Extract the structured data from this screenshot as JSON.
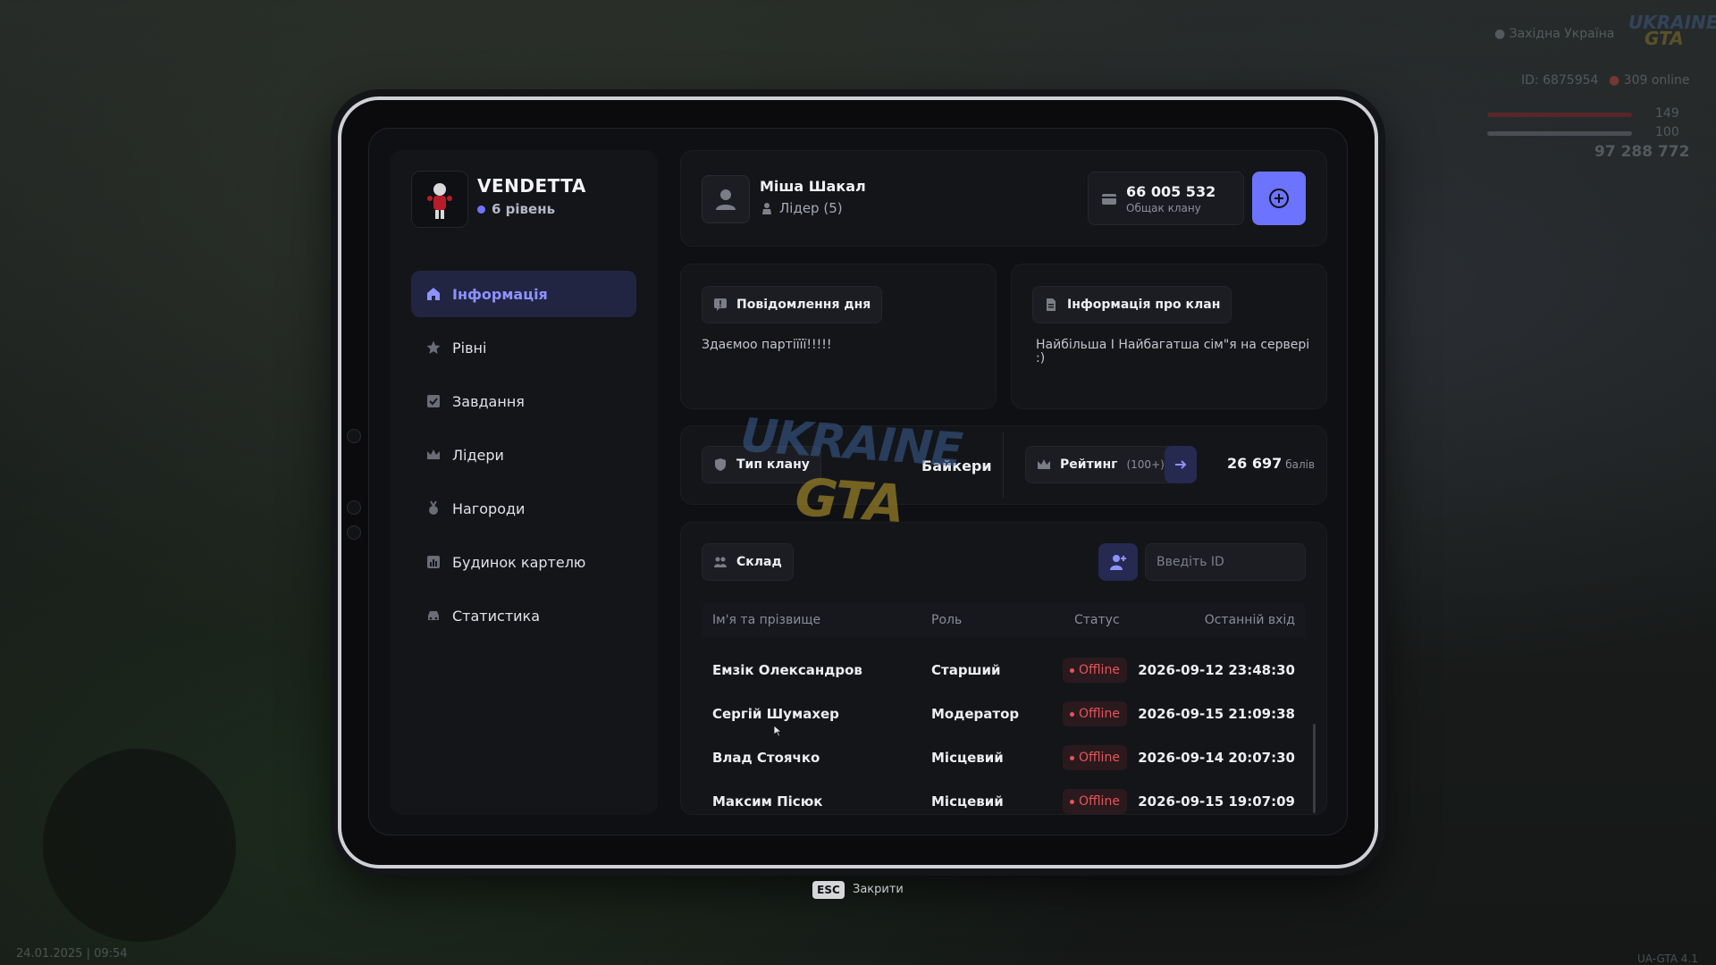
{
  "hud": {
    "region": "Західна Україна",
    "player_id": "ID: 6875954",
    "online": "309 online",
    "health": "149",
    "armor": "100",
    "money": "97 288 772",
    "version": "UA-GTA 4.1",
    "datetime": "24.01.2025 | 09:54",
    "logo_top": "UKRAINE",
    "logo_bottom": "GTA",
    "colors": {
      "health": "#d23a3a",
      "armor": "#9aa0a6"
    }
  },
  "sidebar": {
    "clan_name": "VENDETTA",
    "clan_level": "6 рівень",
    "items": [
      {
        "label": "Інформація",
        "icon": "home-icon",
        "active": true
      },
      {
        "label": "Рівні",
        "icon": "star-icon",
        "active": false
      },
      {
        "label": "Завдання",
        "icon": "checkbox-icon",
        "active": false
      },
      {
        "label": "Лідери",
        "icon": "crown-icon",
        "active": false
      },
      {
        "label": "Нагороди",
        "icon": "medal-icon",
        "active": false
      },
      {
        "label": "Будинок картелю",
        "icon": "chart-icon",
        "active": false
      },
      {
        "label": "Статистика",
        "icon": "car-icon",
        "active": false
      }
    ]
  },
  "leader": {
    "name": "Міша Шакал",
    "role": "Лідер (5)"
  },
  "bank": {
    "amount": "66 005 532",
    "label": "Общак клану"
  },
  "motd": {
    "title": "Повідомлення дня",
    "text": "Здаємоо партіїїї!!!!!"
  },
  "clan_info": {
    "title": "Інформація про клан",
    "text": "Найбільша І Найбагатша сім\"я на сервері :)"
  },
  "clan_type": {
    "title": "Тип клану",
    "value": "Байкери"
  },
  "rating": {
    "title": "Рейтинг",
    "sub": "(100+)",
    "points": "26 697",
    "unit": "балів"
  },
  "roster": {
    "title": "Склад",
    "id_placeholder": "Введіть ID",
    "columns": [
      "Ім'я та прізвище",
      "Роль",
      "Статус",
      "Останній вхід"
    ],
    "rows": [
      {
        "name": "Емзік Олександров",
        "role": "Старший",
        "status": "Offline",
        "last": "2026-09-12 23:48:30"
      },
      {
        "name": "Сергій Шумахер",
        "role": "Модератор",
        "status": "Offline",
        "last": "2026-09-15 21:09:38"
      },
      {
        "name": "Влад Стоячко",
        "role": "Місцевий",
        "status": "Offline",
        "last": "2026-09-14 20:07:30"
      },
      {
        "name": "Максим Пісюк",
        "role": "Місцевий",
        "status": "Offline",
        "last": "2026-09-15 19:07:09"
      }
    ]
  },
  "footer": {
    "key": "ESC",
    "label": "Закрити"
  },
  "colors": {
    "accent": "#6c73ff",
    "active_nav_bg": "#222542",
    "offline": "#e4555b"
  }
}
